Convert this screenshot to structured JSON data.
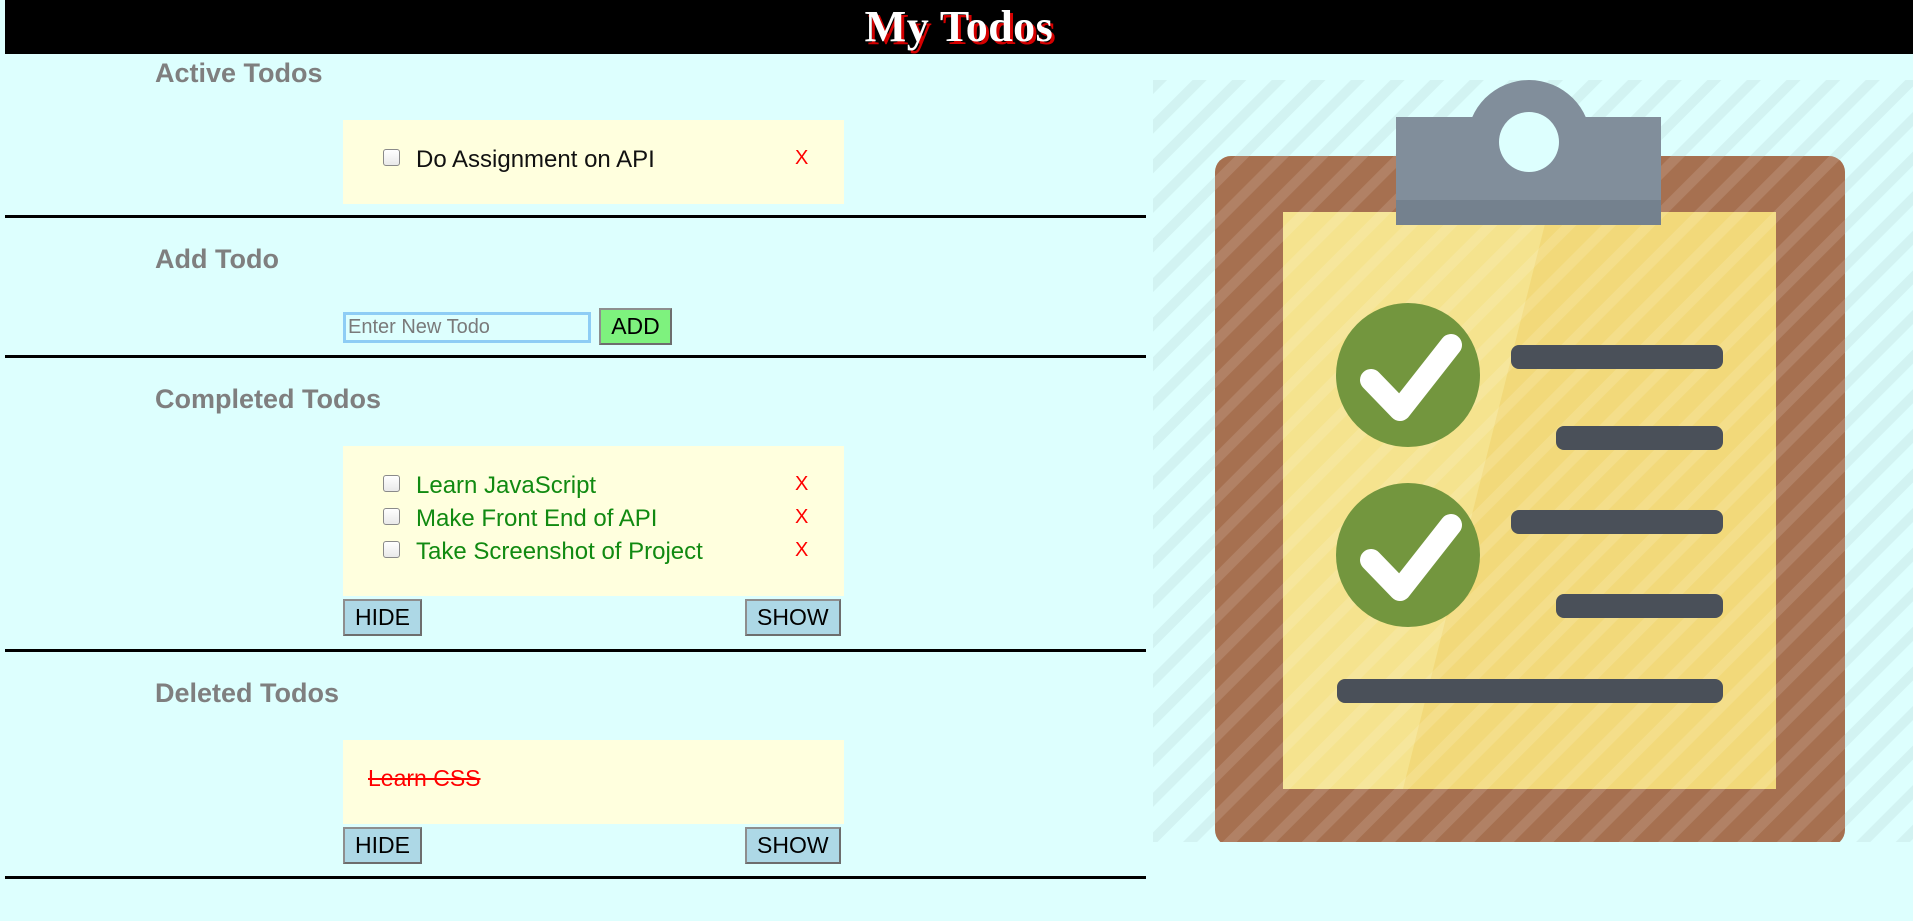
{
  "header": {
    "title": "My Todos"
  },
  "sections": {
    "active": {
      "title": "Active Todos",
      "items": [
        {
          "text": "Do Assignment on API",
          "delete_label": "X"
        }
      ]
    },
    "add": {
      "title": "Add Todo",
      "input_placeholder": "Enter New Todo",
      "input_value": "",
      "button_label": "ADD"
    },
    "completed": {
      "title": "Completed Todos",
      "items": [
        {
          "text": "Learn JavaScript",
          "delete_label": "X"
        },
        {
          "text": "Make Front End of API",
          "delete_label": "X"
        },
        {
          "text": "Take Screenshot of Project",
          "delete_label": "X"
        }
      ],
      "hide_label": "HIDE",
      "show_label": "SHOW"
    },
    "deleted": {
      "title": "Deleted Todos",
      "items": [
        {
          "text": "Learn CSS"
        }
      ],
      "hide_label": "HIDE",
      "show_label": "SHOW"
    }
  },
  "illustration": {
    "icon": "clipboard-checklist-icon"
  },
  "colors": {
    "background": "#ddfffe",
    "header_bg": "#000000",
    "title_shadow": "#d40000",
    "section_title": "#7f7f7f",
    "box_bg": "#ffffde",
    "completed_text": "#118a11",
    "delete_x": "#ff0000",
    "button_bg": "#add8e6",
    "add_button_bg": "#7ef27e"
  }
}
